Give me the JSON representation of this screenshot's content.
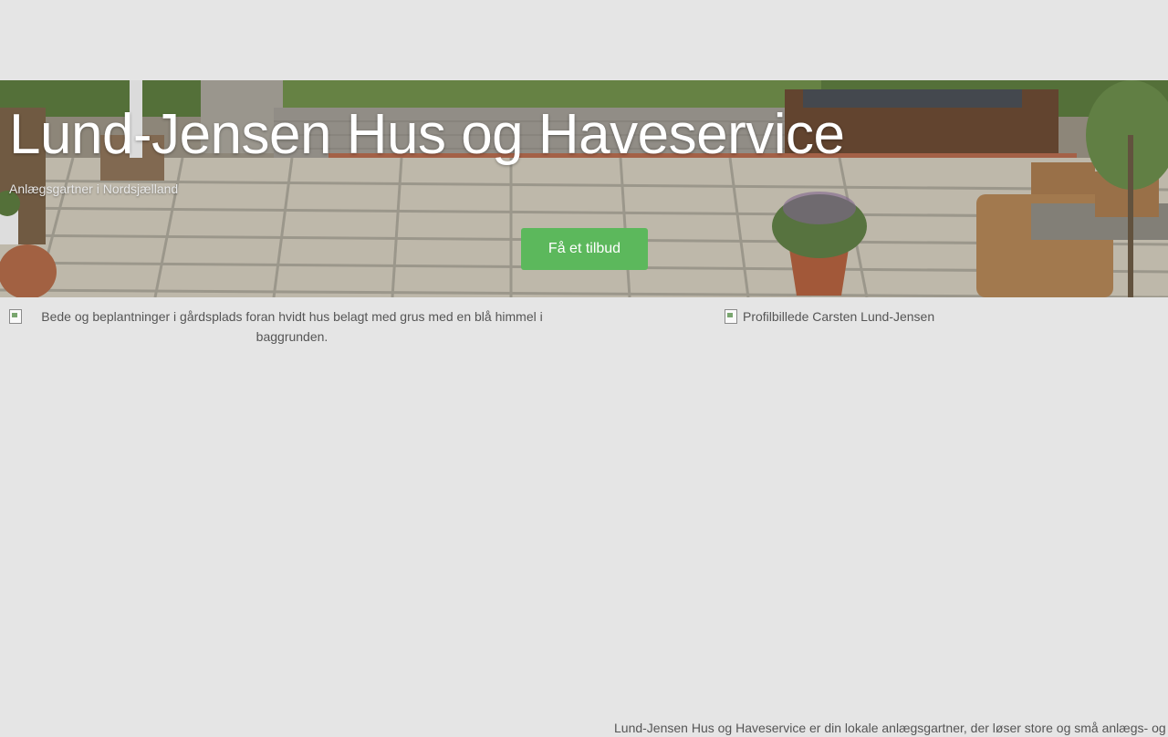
{
  "hero": {
    "title": "Lund-Jensen Hus og Haveservice",
    "subtitle": "Anlægsgartner i Nordsjælland",
    "cta_label": "Få et tilbud"
  },
  "images": {
    "left_alt": "Bede og beplantninger i gårdsplads foran hvidt hus belagt med grus med en blå himmel i baggrunden.",
    "right_alt": "Profilbillede Carsten Lund-Jensen"
  },
  "intro_text": "Lund-Jensen Hus og Haveservice er din lokale anlægsgartner, der løser store og små anlægs- og",
  "colors": {
    "page_bg": "#e5e5e5",
    "cta_bg": "#5cb85c",
    "text": "#555555"
  }
}
